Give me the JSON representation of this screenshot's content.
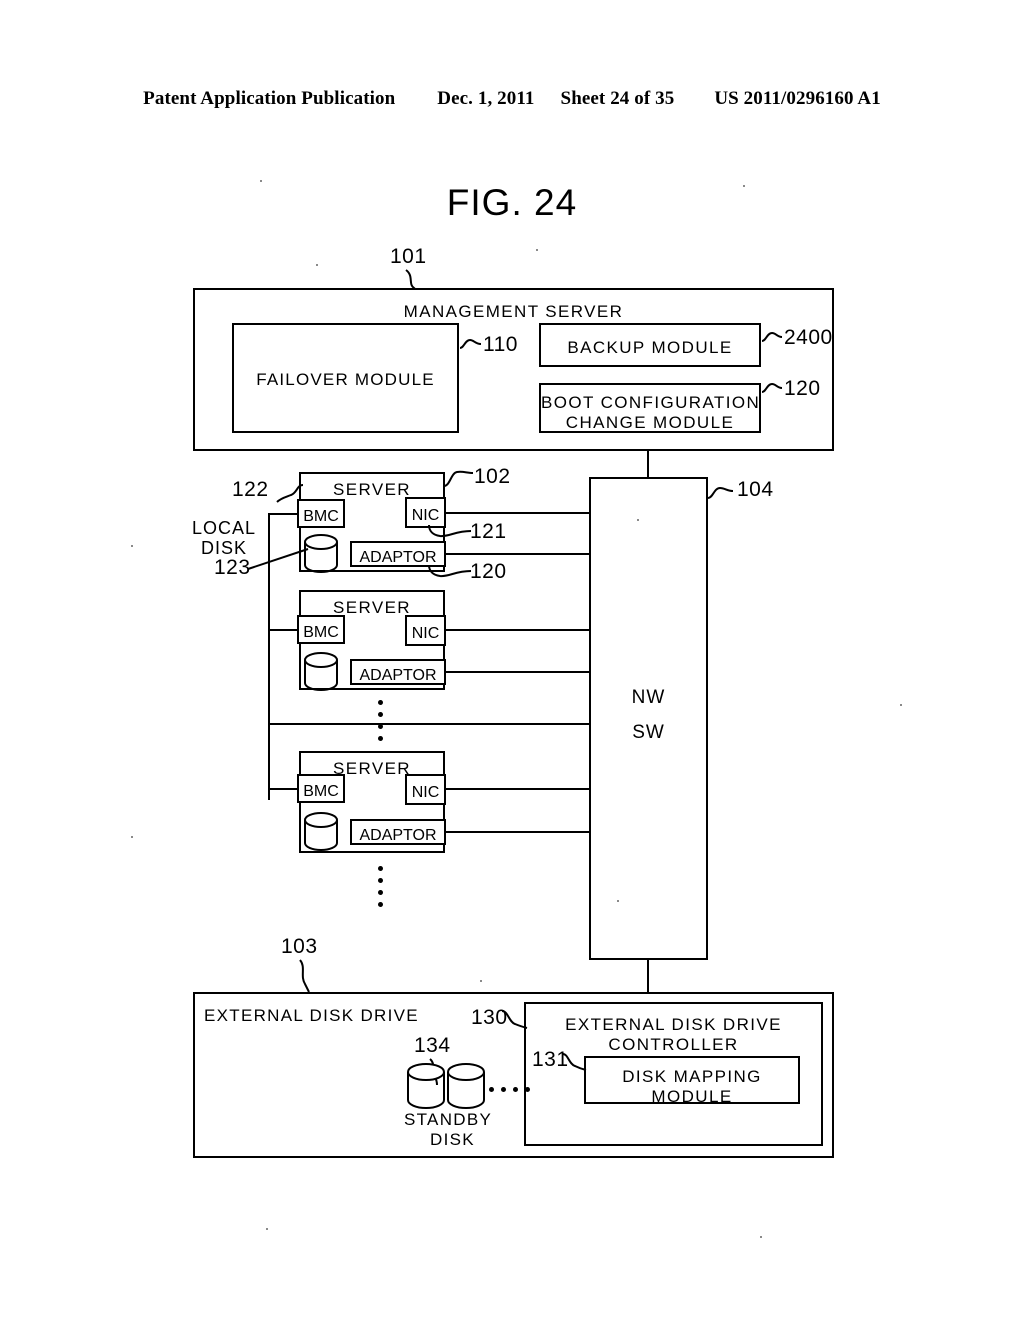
{
  "header": {
    "publication": "Patent Application Publication",
    "date": "Dec. 1, 2011",
    "sheet": "Sheet 24 of 35",
    "number": "US 2011/0296160 A1"
  },
  "figure": {
    "title": "FIG. 24"
  },
  "management_server": {
    "ref": "101",
    "title": "MANAGEMENT SERVER",
    "modules": [
      {
        "label": "FAILOVER MODULE",
        "ref": "110"
      },
      {
        "label": "BACKUP MODULE",
        "ref": "2400"
      },
      {
        "label": "BOOT CONFIGURATION\nCHANGE MODULE",
        "ref": "120",
        "line1": "BOOT CONFIGURATION",
        "line2": "CHANGE MODULE"
      }
    ]
  },
  "servers": {
    "title": "SERVER",
    "first_ref": "102",
    "bmc_label": "BMC",
    "bmc_ref": "122",
    "nic_label": "NIC",
    "nic_ref": "121",
    "adaptor_label": "ADAPTOR",
    "adaptor_ref": "120",
    "local_disk": {
      "line1": "LOCAL",
      "line2": "DISK",
      "ref": "123"
    },
    "items": [
      {
        "title": "SERVER"
      },
      {
        "title": "SERVER"
      },
      {
        "title": "SERVER"
      }
    ]
  },
  "network_switch": {
    "ref": "104",
    "line1": "NW",
    "line2": "SW"
  },
  "external_disk_drive": {
    "ref": "103",
    "title": "EXTERNAL  DISK  DRIVE",
    "controller": {
      "ref": "130",
      "line1": "EXTERNAL  DISK  DRIVE",
      "line2": "CONTROLLER",
      "module": {
        "ref": "131",
        "line1": "DISK MAPPING",
        "line2": "MODULE"
      }
    },
    "standby_disk": {
      "ref": "134",
      "line1": "STANDBY",
      "line2": "DISK"
    }
  },
  "colors": {
    "ink": "#000000",
    "paper": "#ffffff"
  }
}
